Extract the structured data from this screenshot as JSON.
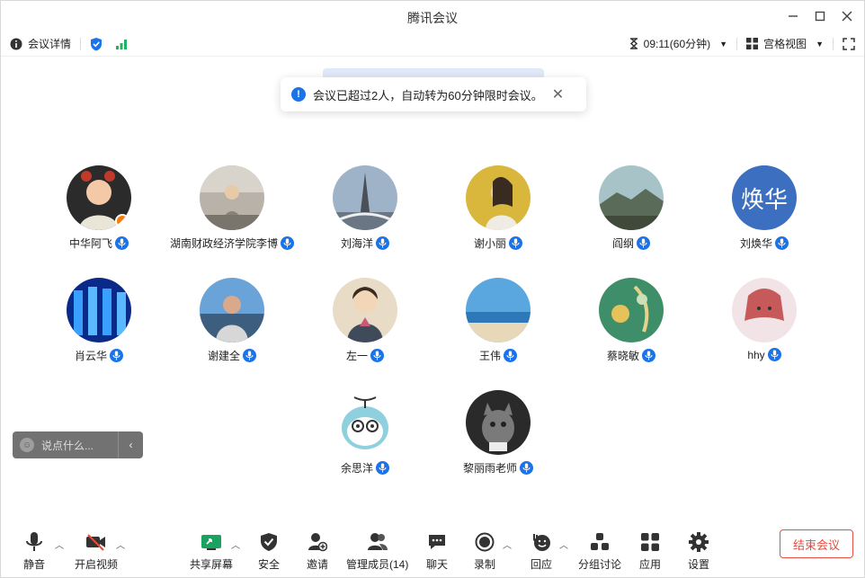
{
  "window": {
    "title": "腾讯会议"
  },
  "infobar": {
    "meeting_details": "会议详情",
    "timer": "09:11(60分钟)",
    "view_mode": "宫格视图"
  },
  "toast": {
    "message": "会议已超过2人，自动转为60分钟限时会议。"
  },
  "participants": [
    {
      "name": "中华阿飞",
      "host": true
    },
    {
      "name": "湖南财政经济学院李博"
    },
    {
      "name": "刘海洋"
    },
    {
      "name": "谢小丽"
    },
    {
      "name": "阎纲"
    },
    {
      "name": "刘焕华",
      "avatar_text": "焕华"
    },
    {
      "name": "肖云华"
    },
    {
      "name": "谢建全"
    },
    {
      "name": "左一"
    },
    {
      "name": "王伟"
    },
    {
      "name": "蔡晓敏"
    },
    {
      "name": "hhy"
    },
    {
      "name": "余思洋"
    },
    {
      "name": "黎丽雨老师"
    }
  ],
  "chat": {
    "placeholder": "说点什么..."
  },
  "toolbar": {
    "mute": "静音",
    "video": "开启视频",
    "share": "共享屏幕",
    "security": "安全",
    "invite": "邀请",
    "members": "管理成员(14)",
    "chat": "聊天",
    "record": "录制",
    "react": "回应",
    "breakout": "分组讨论",
    "apps": "应用",
    "settings": "设置",
    "end": "结束会议"
  },
  "colors": {
    "accent": "#1a73e8",
    "end_red": "#e74c3c",
    "host_orange": "#ff7a00",
    "avatar_blue": "#3c6fbf"
  }
}
